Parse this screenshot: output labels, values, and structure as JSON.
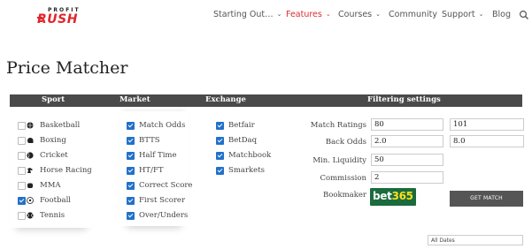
{
  "header": {
    "logo_top": "PROFIT",
    "logo_main": "RUSH",
    "nav": [
      {
        "label": "Starting Out…",
        "dropdown": true,
        "active": false
      },
      {
        "label": "Features",
        "dropdown": true,
        "active": true
      },
      {
        "label": "Courses",
        "dropdown": true,
        "active": false
      },
      {
        "label": "Community",
        "dropdown": false,
        "active": false
      },
      {
        "label": "Support",
        "dropdown": true,
        "active": false
      },
      {
        "label": "Blog",
        "dropdown": false,
        "active": false
      }
    ],
    "search_icon": "search-icon"
  },
  "page": {
    "title": "Price Matcher"
  },
  "table_headers": {
    "sport": "Sport",
    "market": "Market",
    "exchange": "Exchange",
    "filtering": "Filtering settings"
  },
  "sports": [
    {
      "label": "Basketball",
      "checked": false,
      "icon": "basketball-icon"
    },
    {
      "label": "Boxing",
      "checked": false,
      "icon": "boxing-glove-icon"
    },
    {
      "label": "Cricket",
      "checked": false,
      "icon": "cricket-ball-icon"
    },
    {
      "label": "Horse Racing",
      "checked": false,
      "icon": "horse-icon"
    },
    {
      "label": "MMA",
      "checked": false,
      "icon": "mma-glove-icon"
    },
    {
      "label": "Football",
      "checked": true,
      "icon": "football-icon"
    },
    {
      "label": "Tennis",
      "checked": false,
      "icon": "tennis-ball-icon"
    }
  ],
  "markets": [
    {
      "label": "Match Odds",
      "checked": true
    },
    {
      "label": "BTTS",
      "checked": true
    },
    {
      "label": "Half Time",
      "checked": true
    },
    {
      "label": "HT/FT",
      "checked": true
    },
    {
      "label": "Correct Score",
      "checked": true
    },
    {
      "label": "First Scorer",
      "checked": true
    },
    {
      "label": "Over/Unders",
      "checked": true
    }
  ],
  "exchanges": [
    {
      "label": "Betfair",
      "checked": true
    },
    {
      "label": "BetDaq",
      "checked": true
    },
    {
      "label": "Matchbook",
      "checked": true
    },
    {
      "label": "Smarkets",
      "checked": true
    }
  ],
  "filters": {
    "match_ratings_label": "Match Ratings",
    "match_ratings_min": "80",
    "match_ratings_max": "101",
    "back_odds_label": "Back Odds",
    "back_odds_min": "2.0",
    "back_odds_max": "8.0",
    "min_liquidity_label": "Min. Liquidity",
    "min_liquidity": "50",
    "commission_label": "Commission",
    "commission": "2",
    "bookmaker_label": "Bookmaker",
    "bookmaker_logo_text_a": "bet",
    "bookmaker_logo_text_b": "365",
    "get_match_label": "GET MATCH",
    "dates_selected": "All Dates"
  },
  "colors": {
    "accent_red": "#d9302e",
    "header_bar": "#4a4a4a",
    "checkbox_blue": "#2271c9",
    "bet365_green": "#1a6b3d",
    "bet365_yellow": "#ffdf1b"
  }
}
